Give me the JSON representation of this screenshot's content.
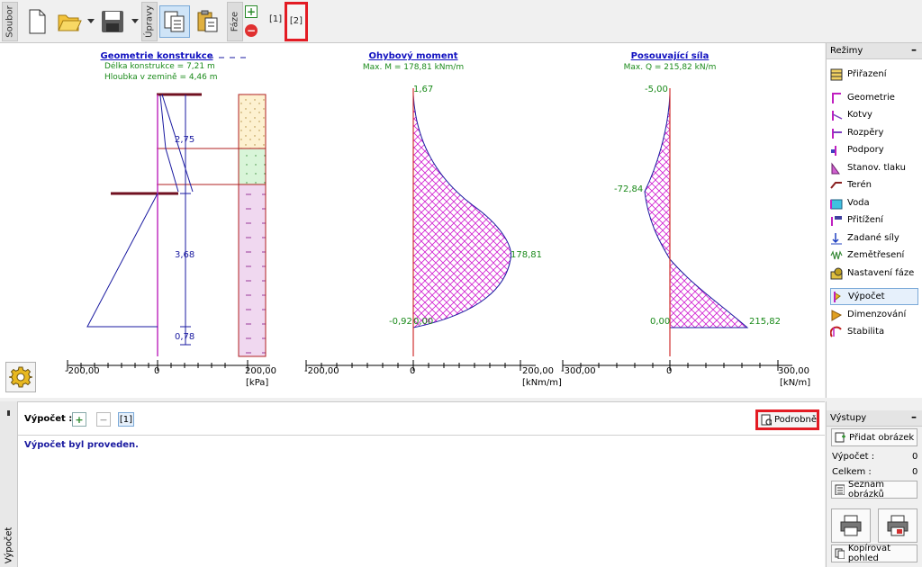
{
  "toolbar": {
    "tab_file": "Soubor",
    "tab_edit": "Úpravy",
    "tab_phase": "Fáze",
    "phase1_label": "[1]",
    "phase2_label": "[2]"
  },
  "geometry": {
    "title": "Geometrie konstrukce",
    "length_line": "Délka konstrukce = 7,21 m",
    "depth_line": "Hloubka v zemině = 4,46 m",
    "dim1": "2,75",
    "dim2": "3,68",
    "dim3": "0,78",
    "axis_left": "-200,00",
    "axis_zero": "0",
    "axis_right": "200,00",
    "axis_unit": "[kPa]"
  },
  "moment": {
    "title": "Ohybový moment",
    "max_line": "Max. M = 178,81 kNm/m",
    "top_value": "1,67",
    "max_value": "178,81",
    "bottom_value": "-0,92",
    "bottom_value2": "0,00",
    "axis_left": "-200,00",
    "axis_zero": "0",
    "axis_right": "200,00",
    "axis_unit": "[kNm/m]"
  },
  "shear": {
    "title": "Posouvající síla",
    "max_line": "Max. Q = 215,82 kN/m",
    "top_value": "-5,00",
    "min_value": "-72,84",
    "bottom_left_value": "0,00",
    "bottom_right_value": "215,82",
    "axis_left": "-300,00",
    "axis_zero": "0",
    "axis_right": "300,00",
    "axis_unit": "[kN/m]"
  },
  "modes": {
    "header": "Režimy",
    "items": [
      {
        "label": "Přiřazení",
        "icon": "assignment-icon"
      },
      {
        "label": "Geometrie",
        "icon": "geometry-icon"
      },
      {
        "label": "Kotvy",
        "icon": "anchors-icon"
      },
      {
        "label": "Rozpěry",
        "icon": "struts-icon"
      },
      {
        "label": "Podpory",
        "icon": "supports-icon"
      },
      {
        "label": "Stanov. tlaku",
        "icon": "pressure-icon"
      },
      {
        "label": "Terén",
        "icon": "terrain-icon"
      },
      {
        "label": "Voda",
        "icon": "water-icon"
      },
      {
        "label": "Přitížení",
        "icon": "surcharge-icon"
      },
      {
        "label": "Zadané síly",
        "icon": "forces-icon"
      },
      {
        "label": "Zemětřesení",
        "icon": "earthquake-icon"
      },
      {
        "label": "Nastavení fáze",
        "icon": "phase-settings-icon"
      },
      {
        "label": "Výpočet",
        "icon": "analysis-icon"
      },
      {
        "label": "Dimenzování",
        "icon": "dimensioning-icon"
      },
      {
        "label": "Stabilita",
        "icon": "stability-icon"
      }
    ]
  },
  "bottom": {
    "side_label": "Výpočet",
    "calc_label": "Výpočet :",
    "calc_tab": "[1]",
    "details_button": "Podrobně",
    "message": "Výpočet byl proveden."
  },
  "outputs": {
    "header": "Výstupy",
    "add_picture": "Přidat obrázek",
    "calc_label": "Výpočet :",
    "calc_count": "0",
    "total_label": "Celkem :",
    "total_count": "0",
    "list_pictures": "Seznam obrázků",
    "copy_view": "Kopírovat pohled"
  },
  "colors": {
    "highlight": "#e31b23",
    "title_blue": "#1010c0",
    "value_green": "#1a8a1a",
    "diagram_magenta": "#d11fd1",
    "structure_blue": "#1a1aa0"
  }
}
